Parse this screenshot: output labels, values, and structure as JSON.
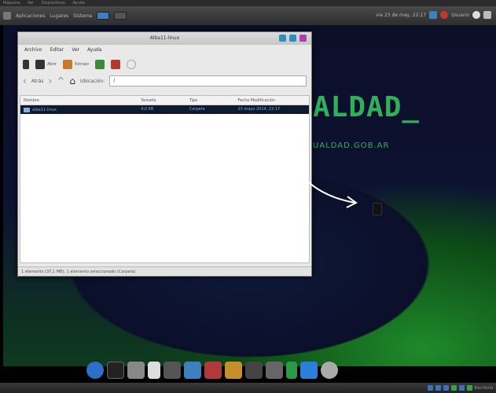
{
  "host_menu": [
    "Máquina",
    "Ver",
    "Dispositivos",
    "Ayuda"
  ],
  "top_panel": {
    "menus": [
      "Aplicaciones",
      "Lugares",
      "Sistema"
    ],
    "clock": "vie 23 de may, 22:17",
    "user": "Usuario"
  },
  "desktop": {
    "brand_text": "ALDAD_",
    "brand_url": "UALDAD.GOB.AR"
  },
  "file_manager": {
    "title": "Alba11-linux",
    "menu": [
      "Archivo",
      "Editar",
      "Ver",
      "Ayuda"
    ],
    "toolbar": [
      "Abrir",
      "Extraer"
    ],
    "location": {
      "back": "Atrás",
      "path_label": "Ubicación:",
      "path_value": "/"
    },
    "columns": [
      "Nombre",
      "Tamaño",
      "Tipo",
      "Fecha Modificación"
    ],
    "rows": [
      {
        "name": "alba11-linux",
        "size": "4,0 KB",
        "type": "Carpeta",
        "modified": "23 mayo 2014, 22:17"
      }
    ],
    "status": "1 elemento (37,1 MB), 1 elemento seleccionado (Carpeta)"
  },
  "bottom_panel": {
    "workspace": "Escritorio"
  },
  "colors": {
    "brand_green": "#2fb15a",
    "selection": "#0f1a2e",
    "accent_blue": "#2b8fbf"
  }
}
